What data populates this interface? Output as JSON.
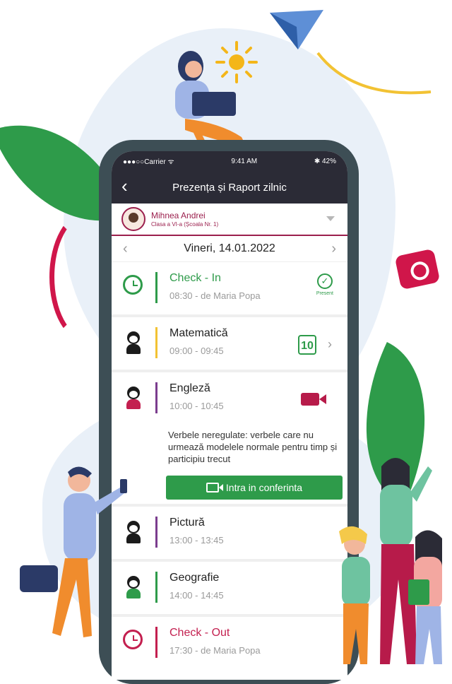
{
  "status_bar": {
    "carrier": "●●●○○Carrier ᯤ",
    "time": "9:41 AM",
    "battery": "✱ 42%"
  },
  "nav": {
    "back": "‹",
    "title": "Prezența și Raport zilnic"
  },
  "student": {
    "name": "Mihnea Andrei",
    "class": "Clasa a VI-a (Școala Nr. 1)"
  },
  "date_nav": {
    "prev": "‹",
    "date": "Vineri, 14.01.2022",
    "next": "›"
  },
  "schedule": [
    {
      "subject": "Check - In",
      "time": "08:30 - de Maria Popa",
      "status": "Present",
      "color": "#2e9b4a"
    },
    {
      "subject": "Matematică",
      "time": "09:00 - 09:45",
      "grade": "10",
      "color": "#f2c233"
    },
    {
      "subject": "Engleză",
      "time": "10:00 - 10:45",
      "color": "#7b3d8e",
      "description": "Verbele neregulate: verbele care nu urmează modelele normale pentru timp și participiu trecut",
      "button": "Intra in conferinta"
    },
    {
      "subject": "Pictură",
      "time": "13:00 - 13:45",
      "color": "#7b3d8e"
    },
    {
      "subject": "Geografie",
      "time": "14:00 - 14:45",
      "color": "#2e9b4a"
    },
    {
      "subject": "Check - Out",
      "time": "17:30 - de Maria Popa",
      "color": "#c31f4f"
    }
  ],
  "colors": {
    "accent": "#9b1f4d",
    "green": "#2e9b4a",
    "dark": "#2b2b36",
    "red": "#c31f4f"
  }
}
